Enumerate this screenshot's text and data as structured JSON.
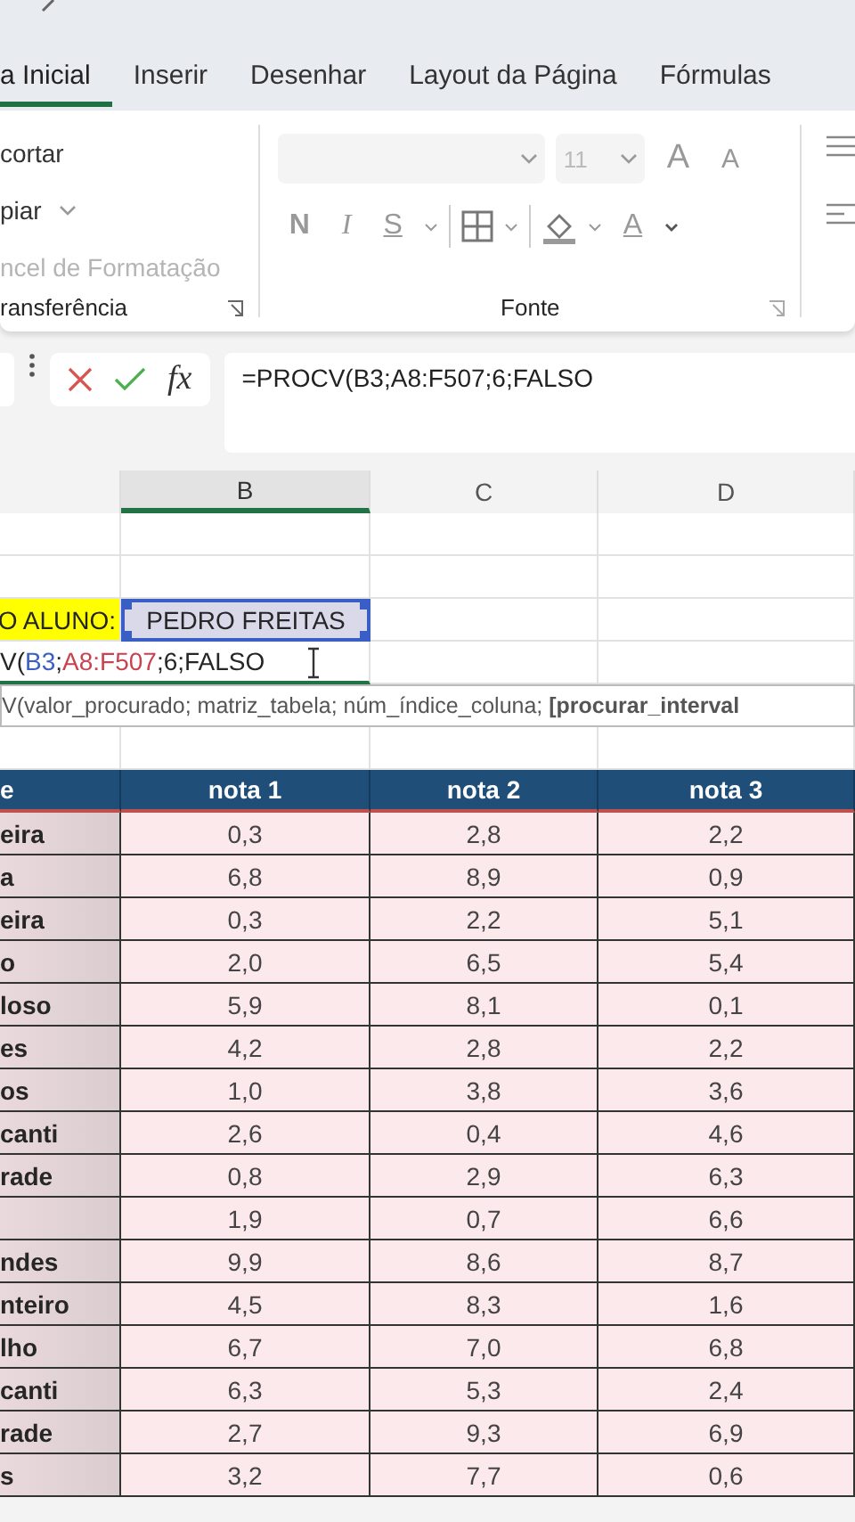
{
  "ribbon_tabs": [
    {
      "label": "a Inicial",
      "selected": true
    },
    {
      "label": "Inserir",
      "selected": false
    },
    {
      "label": "Desenhar",
      "selected": false
    },
    {
      "label": "Layout da Página",
      "selected": false
    },
    {
      "label": "Fórmulas",
      "selected": false
    }
  ],
  "clipboard_group": {
    "items": [
      {
        "label": "cortar",
        "dropdown": false,
        "disabled": false
      },
      {
        "label": "piar",
        "dropdown": true,
        "disabled": false
      },
      {
        "label": "ncel de Formatação",
        "dropdown": false,
        "disabled": true
      }
    ],
    "label": "ransferência"
  },
  "font_group": {
    "disabled": true,
    "font_size": "11",
    "grow_label": "A",
    "shrink_label": "A",
    "format_buttons": [
      {
        "kind": "bold",
        "label": "N"
      },
      {
        "kind": "italic",
        "label": "I"
      },
      {
        "kind": "underline",
        "label": "S"
      }
    ],
    "font_color_label": "A",
    "label": "Fonte"
  },
  "formula_bar": {
    "function_label": "fx",
    "formula": "=PROCV(B3;A8:F507;6;FALSO"
  },
  "column_headers": [
    {
      "label": "B",
      "selected": true
    },
    {
      "label": "C",
      "selected": false
    },
    {
      "label": "D",
      "selected": false
    }
  ],
  "sheet": {
    "label_cell": "O ALUNO:",
    "value_cell": "PEDRO FREITAS",
    "editing_parts": [
      {
        "text": "V("
      },
      {
        "text": "B3",
        "color": "#3a5fc4"
      },
      {
        "text": ";"
      },
      {
        "text": "A8:F507",
        "color": "#c8434f"
      },
      {
        "text": ";6;FALSO"
      }
    ],
    "tooltip": "V(valor_procurado; matriz_tabela; núm_índice_coluna; **[procurar_interval**"
  },
  "table": {
    "columns": [
      "e",
      "nota 1",
      "nota 2",
      "nota 3"
    ],
    "rows": [
      {
        "name": "eira",
        "values": [
          "0,3",
          "2,8",
          "2,2"
        ]
      },
      {
        "name": "a",
        "values": [
          "6,8",
          "8,9",
          "0,9"
        ]
      },
      {
        "name": "eira",
        "values": [
          "0,3",
          "2,2",
          "5,1"
        ]
      },
      {
        "name": "o",
        "values": [
          "2,0",
          "6,5",
          "5,4"
        ]
      },
      {
        "name": "loso",
        "values": [
          "5,9",
          "8,1",
          "0,1"
        ]
      },
      {
        "name": "es",
        "values": [
          "4,2",
          "2,8",
          "2,2"
        ]
      },
      {
        "name": "os",
        "values": [
          "1,0",
          "3,8",
          "3,6"
        ]
      },
      {
        "name": "canti",
        "values": [
          "2,6",
          "0,4",
          "4,6"
        ]
      },
      {
        "name": "rade",
        "values": [
          "0,8",
          "2,9",
          "6,3"
        ]
      },
      {
        "values": [
          "1,9",
          "0,7",
          "6,6"
        ]
      },
      {
        "name": "ndes",
        "values": [
          "9,9",
          "8,6",
          "8,7"
        ]
      },
      {
        "name": "nteiro",
        "values": [
          "4,5",
          "8,3",
          "1,6"
        ]
      },
      {
        "name": "lho",
        "values": [
          "6,7",
          "7,0",
          "6,8"
        ]
      },
      {
        "name": "canti",
        "values": [
          "6,3",
          "5,3",
          "2,4"
        ]
      },
      {
        "name": "rade",
        "values": [
          "2,7",
          "9,3",
          "6,9"
        ]
      },
      {
        "name": "s",
        "values": [
          "3,2",
          "7,7",
          "0,6"
        ]
      }
    ]
  }
}
